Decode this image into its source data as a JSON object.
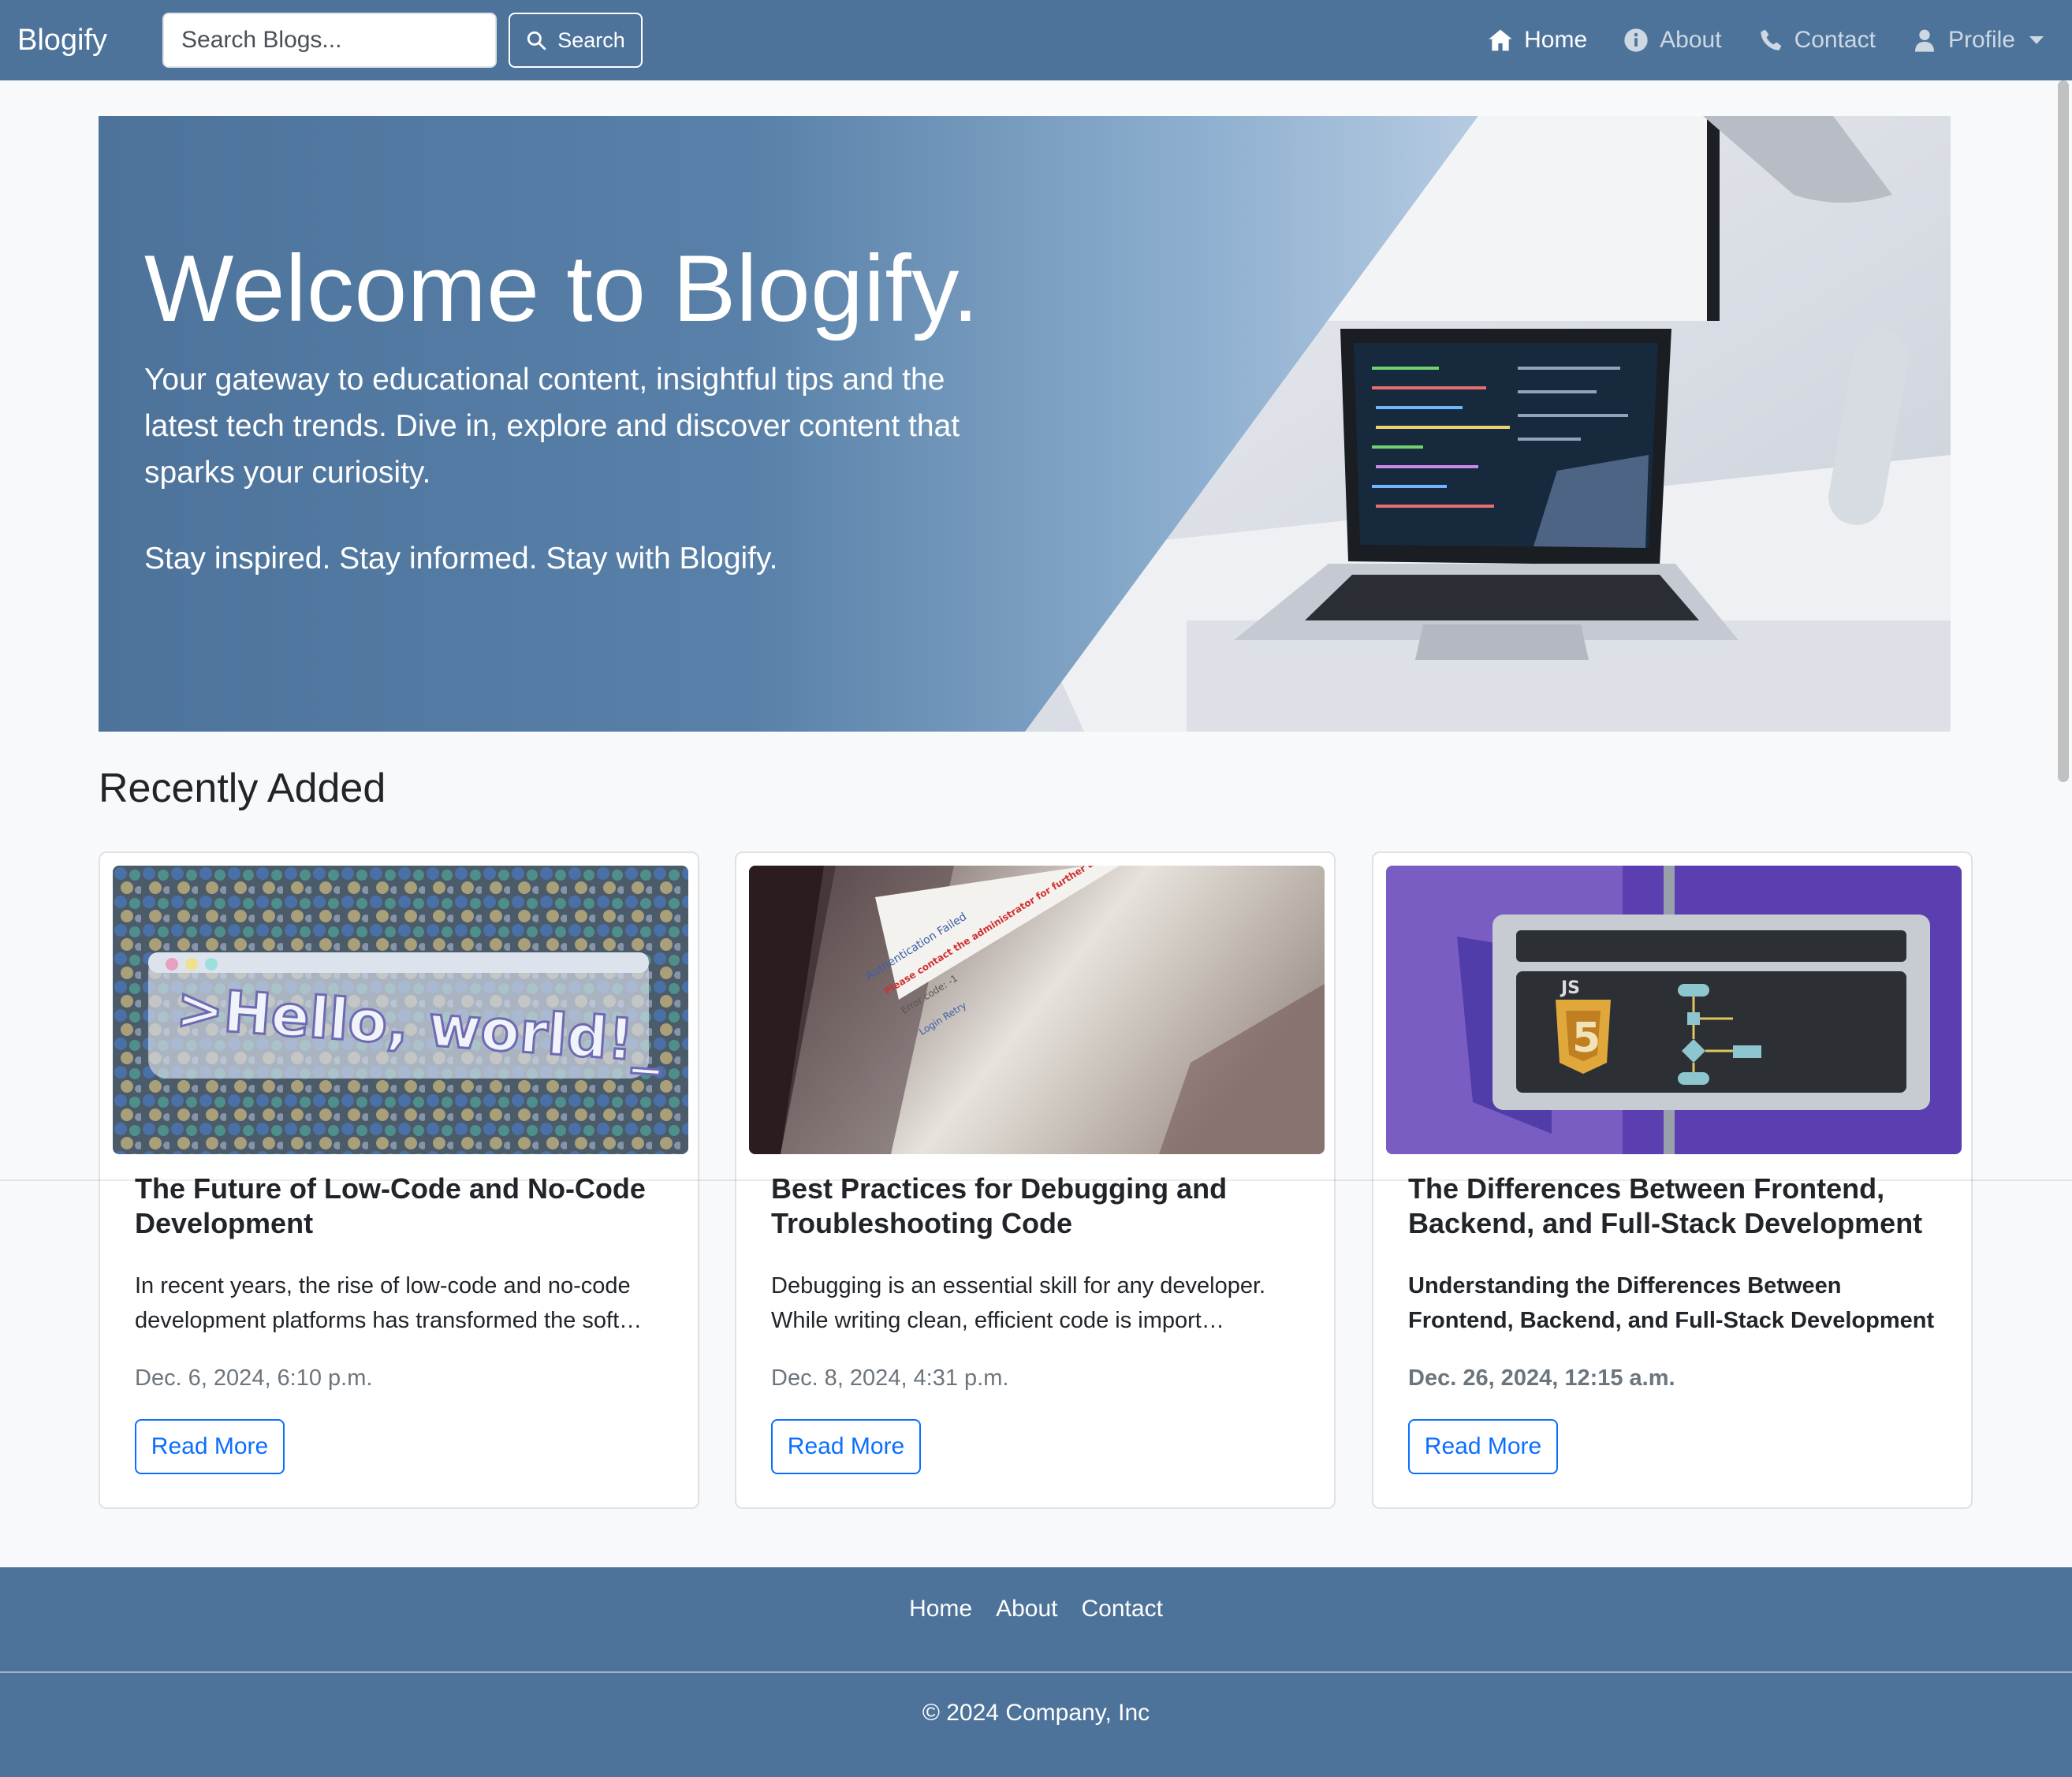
{
  "navbar": {
    "brand": "Blogify",
    "search_placeholder": "Search Blogs...",
    "search_button": "Search",
    "links": [
      {
        "label": "Home",
        "icon": "home-icon",
        "active": true
      },
      {
        "label": "About",
        "icon": "info-icon",
        "active": false
      },
      {
        "label": "Contact",
        "icon": "phone-icon",
        "active": false
      },
      {
        "label": "Profile",
        "icon": "user-icon",
        "active": false
      }
    ]
  },
  "hero": {
    "title": "Welcome to Blogify.",
    "text": "Your gateway to educational content, insightful tips and the latest tech trends. Dive in, explore and discover content that sparks your curiosity.",
    "tagline": "Stay inspired. Stay informed. Stay with Blogify."
  },
  "recent": {
    "heading": "Recently Added",
    "posts": [
      {
        "image_text": ">Hello, world!_",
        "title": "The Future of Low-Code and No-Code Development",
        "excerpt": "In recent years, the rise of low-code and no-code development platforms has transformed the soft…",
        "date": "Dec. 6, 2024, 6:10 p.m.",
        "button": "Read More"
      },
      {
        "image_text": [
          "Authentication Failed",
          "Please contact the administrator for further assistance",
          "Error code: -1",
          "Login Retry"
        ],
        "title": "Best Practices for Debugging and Troubleshooting Code",
        "excerpt": "Debugging is an essential skill for any developer. While writing clean, efficient code is import…",
        "date": "Dec. 8, 2024, 4:31 p.m.",
        "button": "Read More"
      },
      {
        "image_text": "JS",
        "title": "The Differences Between Frontend, Backend, and Full-Stack Development",
        "excerpt": "Understanding the Differences Between Frontend, Backend, and Full-Stack Development",
        "date": "Dec. 26, 2024, 12:15 a.m.",
        "button": "Read More"
      }
    ]
  },
  "footer": {
    "links": [
      "Home",
      "About",
      "Contact"
    ],
    "copyright": "© 2024 Company, Inc"
  },
  "colors": {
    "primary": "#4d739b",
    "accent": "#0d6efd",
    "muted": "#6c757d"
  }
}
